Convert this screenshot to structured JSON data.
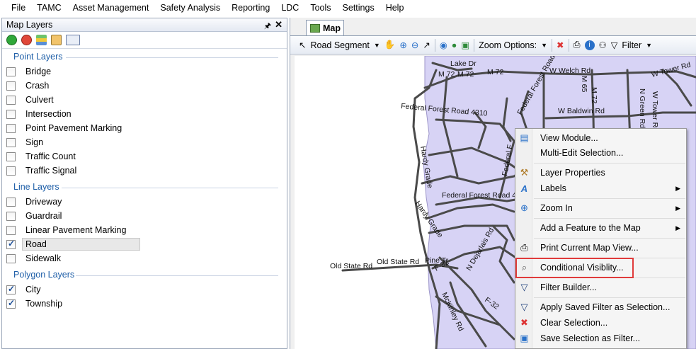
{
  "menu": [
    "File",
    "TAMC",
    "Asset Management",
    "Safety Analysis",
    "Reporting",
    "LDC",
    "Tools",
    "Settings",
    "Help"
  ],
  "left_panel": {
    "title": "Map Layers",
    "groups": {
      "point": {
        "label": "Point Layers",
        "items": [
          {
            "label": "Bridge",
            "checked": false
          },
          {
            "label": "Crash",
            "checked": false
          },
          {
            "label": "Culvert",
            "checked": false
          },
          {
            "label": "Intersection",
            "checked": false
          },
          {
            "label": "Point Pavement Marking",
            "checked": false
          },
          {
            "label": "Sign",
            "checked": false
          },
          {
            "label": "Traffic Count",
            "checked": false
          },
          {
            "label": "Traffic Signal",
            "checked": false
          }
        ]
      },
      "line": {
        "label": "Line Layers",
        "items": [
          {
            "label": "Driveway",
            "checked": false
          },
          {
            "label": "Guardrail",
            "checked": false
          },
          {
            "label": "Linear Pavement Marking",
            "checked": false
          },
          {
            "label": "Road",
            "checked": true
          },
          {
            "label": "Sidewalk",
            "checked": false
          }
        ]
      },
      "polygon": {
        "label": "Polygon Layers",
        "items": [
          {
            "label": "City",
            "checked": true
          },
          {
            "label": "Township",
            "checked": true
          }
        ]
      }
    }
  },
  "map_tab": {
    "label": "Map"
  },
  "map_toolbar": {
    "layer_select": "Road Segment",
    "zoom_options": "Zoom Options:",
    "filter": "Filter"
  },
  "map_labels": [
    "Lake Dr",
    "M 72",
    "M 72",
    "M 72",
    "W Welch Rd",
    "M 65",
    "W Tower Rd",
    "M 72",
    "N Green Rd",
    "W Tower Rd",
    "W Baldwin Rd",
    "Federal Forest Road 4310",
    "Federal Forest Road 4310",
    "Federal Forest Road 4",
    "Hardy Grade",
    "Hardy Grade",
    "Old State Rd",
    "Old State Rd",
    "Pine Tr",
    "N Dejarlais Rd",
    "F-32",
    "F-32",
    "McKinley Rd",
    "Federal F"
  ],
  "context_menu": [
    {
      "label": "View Module...",
      "icon": "module-icon"
    },
    {
      "label": "Multi-Edit Selection...",
      "icon": ""
    },
    {
      "label": "Layer Properties",
      "icon": "layer-properties-icon"
    },
    {
      "label": "Labels",
      "icon": "labels-icon",
      "submenu": true
    },
    {
      "label": "Zoom In",
      "icon": "zoom-icon",
      "submenu": true
    },
    {
      "label": "Add a Feature to the Map",
      "icon": "",
      "submenu": true
    },
    {
      "label": "Print Current Map View...",
      "icon": "printer-icon"
    },
    {
      "label": "Conditional Visiblity...",
      "icon": "magnifier-icon"
    },
    {
      "label": "Filter Builder...",
      "icon": "filter-icon"
    },
    {
      "label": "Apply Saved Filter as Selection...",
      "icon": "filter-icon"
    },
    {
      "label": "Clear Selection...",
      "icon": "clear-filter-icon"
    },
    {
      "label": "Save Selection as Filter...",
      "icon": "save-filter-icon"
    }
  ],
  "colors": {
    "polygon_fill": "#d7d3f5",
    "road": "#4a4a4a",
    "accent": "#1f5fa8",
    "highlight": "#e03b3b"
  }
}
